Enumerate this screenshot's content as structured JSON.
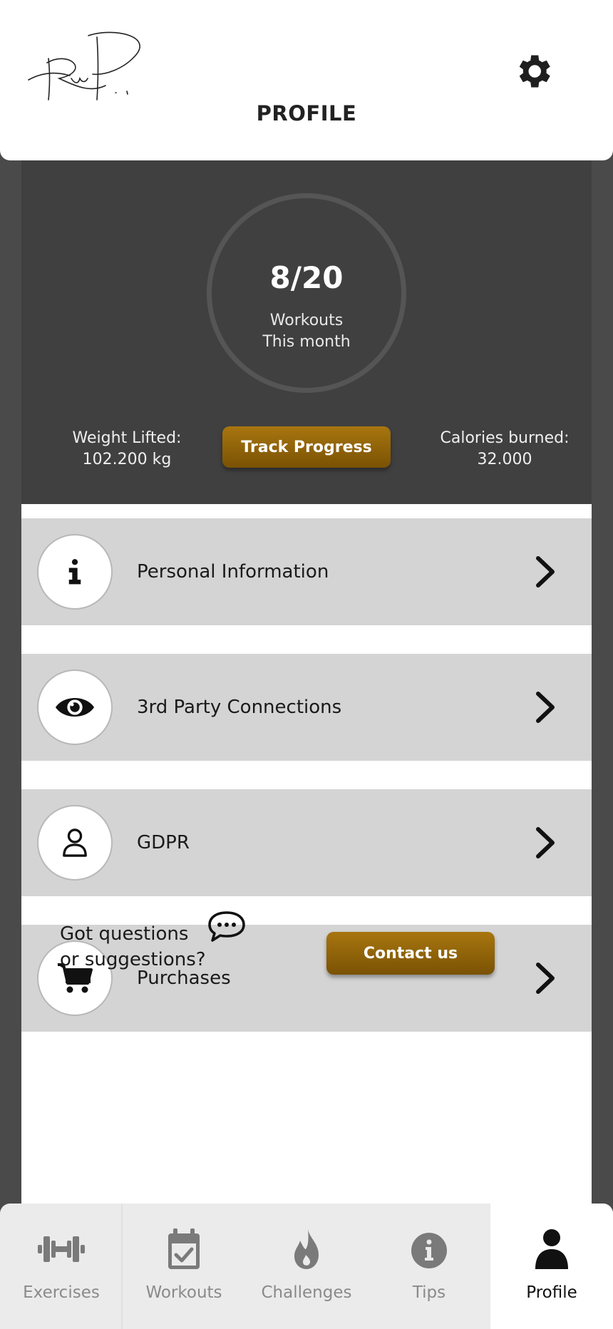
{
  "header": {
    "title": "PROFILE",
    "signature_icon": "signature-logo",
    "settings_icon": "gear-icon"
  },
  "stats": {
    "workouts_count": "8/20",
    "workouts_label_line1": "Workouts",
    "workouts_label_line2": "This month",
    "weight_label": "Weight Lifted:",
    "weight_value": "102.200 kg",
    "calories_label": "Calories burned:",
    "calories_value": "32.000",
    "track_button": "Track Progress"
  },
  "menu": {
    "items": [
      {
        "label": "Personal Information",
        "icon": "info-icon"
      },
      {
        "label": "3rd Party Connections",
        "icon": "eye-icon"
      },
      {
        "label": "GDPR",
        "icon": "user-icon"
      },
      {
        "label": "Purchases",
        "icon": "cart-icon"
      }
    ]
  },
  "contact": {
    "line1": "Got questions",
    "line2": "or suggestions?",
    "button": "Contact us",
    "icon": "chat-icon"
  },
  "nav": {
    "items": [
      {
        "label": "Exercises",
        "icon": "dumbbell-icon"
      },
      {
        "label": "Workouts",
        "icon": "calendar-check-icon"
      },
      {
        "label": "Challenges",
        "icon": "flame-icon"
      },
      {
        "label": "Tips",
        "icon": "info-circle-icon"
      },
      {
        "label": "Profile",
        "icon": "user-icon"
      }
    ],
    "active": "Profile"
  },
  "colors": {
    "accent_gold": "#8f6408",
    "panel_dark": "#404040",
    "menu_gray": "#d4d4d4",
    "nav_bg": "#ebebeb"
  }
}
